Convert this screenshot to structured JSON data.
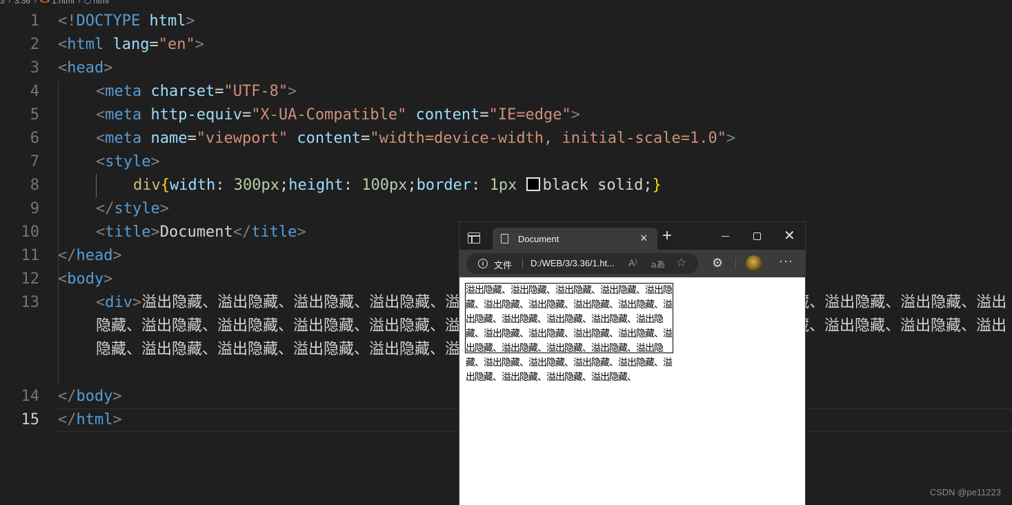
{
  "breadcrumb": {
    "items": [
      "3",
      "3.36",
      "1.html",
      "html"
    ]
  },
  "editor": {
    "line_numbers": [
      "1",
      "2",
      "3",
      "4",
      "5",
      "6",
      "7",
      "8",
      "9",
      "10",
      "11",
      "12",
      "13",
      "14",
      "15"
    ],
    "active_line": "15",
    "lines": {
      "l1": {
        "open": "<!",
        "keyword": "DOCTYPE",
        "space": " ",
        "attr": "html",
        "close": ">"
      },
      "l2": {
        "open": "<",
        "tag": "html",
        "attr": "lang",
        "eq": "=",
        "value": "\"en\"",
        "close": ">"
      },
      "l3": {
        "open": "<",
        "tag": "head",
        "close": ">"
      },
      "l4": {
        "open": "<",
        "tag": "meta",
        "attr": "charset",
        "eq": "=",
        "value": "\"UTF-8\"",
        "close": ">"
      },
      "l5": {
        "open": "<",
        "tag": "meta",
        "attr1": "http-equiv",
        "eq": "=",
        "value1": "\"X-UA-Compatible\"",
        "attr2": "content",
        "value2": "\"IE=edge\"",
        "close": ">"
      },
      "l6": {
        "open": "<",
        "tag": "meta",
        "attr1": "name",
        "eq": "=",
        "value1": "\"viewport\"",
        "attr2": "content",
        "value2": "\"width=device-width, initial-scale=1.0\"",
        "close": ">"
      },
      "l7": {
        "open": "<",
        "tag": "style",
        "close": ">"
      },
      "l8": {
        "selector": "div",
        "brace_open": "{",
        "p1": "width",
        "colon": ": ",
        "v1": "300px",
        "semi": ";",
        "p2": "height",
        "v2": "100px",
        "p3": "border",
        "v3": "1px",
        "v3b": "black solid",
        "brace_close": "}"
      },
      "l9": {
        "open": "</",
        "tag": "style",
        "close": ">"
      },
      "l10": {
        "open": "<",
        "tag": "title",
        "close": ">",
        "text": "Document",
        "end_open": "</"
      },
      "l11": {
        "open": "</",
        "tag": "head",
        "close": ">"
      },
      "l12": {
        "open": "<",
        "tag": "body",
        "close": ">"
      },
      "l13": {
        "open": "<",
        "tag": "div",
        "close": ">",
        "end_open": "</",
        "text": "溢出隐藏、溢出隐藏、溢出隐藏、溢出隐藏、溢出隐藏、溢出隐藏、溢出隐藏、溢出隐藏、溢出隐藏、溢出隐藏、溢出隐藏、溢出隐藏、溢出隐藏、溢出隐藏、溢出隐藏、溢出隐藏、溢出隐藏、溢出隐藏、溢出隐藏、溢出隐藏、溢出隐藏、溢出隐藏、溢出隐藏、溢出隐藏、溢出隐藏、溢出隐藏、溢出隐藏、溢出隐藏、溢出隐藏、溢出隐藏、溢出隐藏"
      },
      "l14": {
        "open": "</",
        "tag": "body",
        "close": ">"
      },
      "l15": {
        "open": "</",
        "tag": "html",
        "close": ">"
      }
    }
  },
  "browser": {
    "tab_title": "Document",
    "tab_close": "×",
    "new_tab": "+",
    "win_close": "✕",
    "site_info_label": "文件",
    "url": "D:/WEB/3/3.36/1.ht...",
    "read_aloud_icon_glyph": "A⁾",
    "translate_icon_glyph": "aあ",
    "favorites_icon_glyph": "☆",
    "extensions_icon_glyph": "⚙",
    "more_icon_glyph": "···",
    "page_text": "溢出隐藏、溢出隐藏、溢出隐藏、溢出隐藏、溢出隐藏、溢出隐藏、溢出隐藏、溢出隐藏、溢出隐藏、溢出隐藏、溢出隐藏、溢出隐藏、溢出隐藏、溢出隐藏、溢出隐藏、溢出隐藏、溢出隐藏、溢出隐藏、溢出隐藏、溢出隐藏、溢出隐藏、溢出隐藏、溢出隐藏、溢出隐藏、溢出隐藏、溢出隐藏、溢出隐藏、溢出隐藏、溢出隐藏、溢出隐藏、溢出隐藏、"
  },
  "watermark": "CSDN @pe11223",
  "colors": {
    "editor_bg": "#1f1f1f",
    "tag": "#569cd6",
    "attr": "#9cdcfe",
    "string": "#ce9178",
    "number": "#b5cea8",
    "selector": "#d7ba7d",
    "bracket": "#ffd700"
  }
}
